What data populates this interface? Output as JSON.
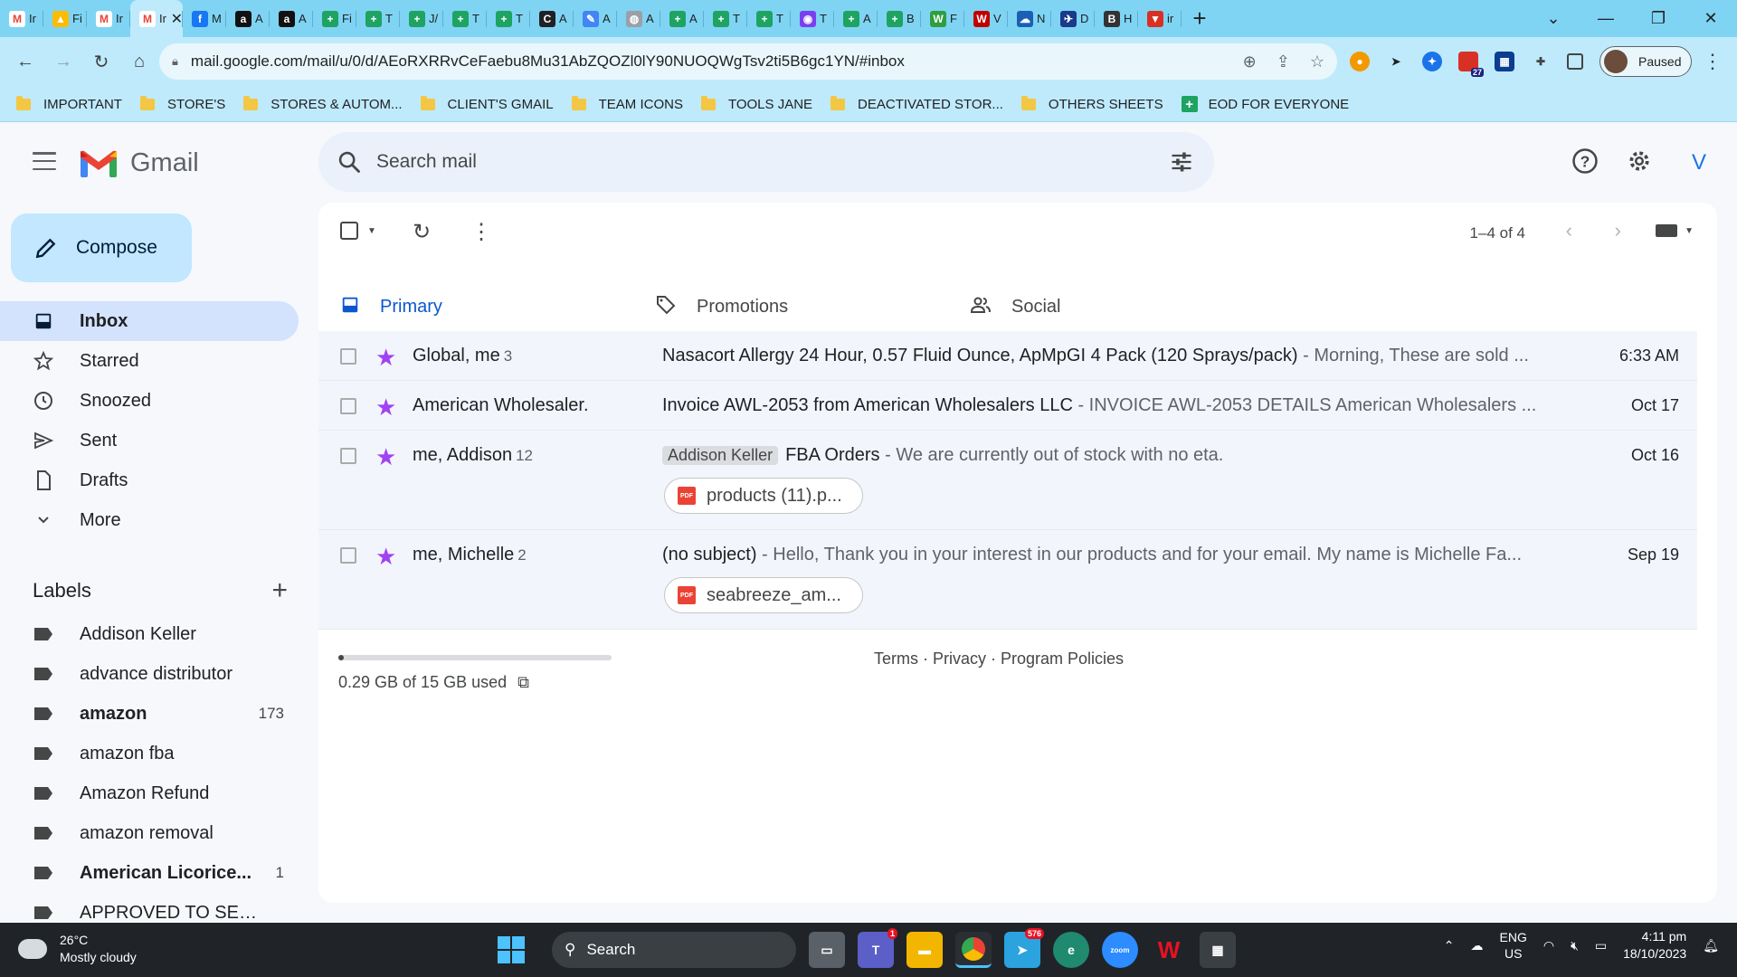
{
  "browser": {
    "tabs": [
      {
        "icon": "gmail-icon",
        "letter": "M",
        "color": "#ffffff",
        "title": "Ir"
      },
      {
        "icon": "drive-icon",
        "letter": "▲",
        "color": "#fbbc04",
        "title": "Fi"
      },
      {
        "icon": "gmail-icon",
        "letter": "M",
        "color": "#ffffff",
        "title": "Ir"
      },
      {
        "icon": "facebook-icon",
        "letter": "f",
        "color": "#1877f2",
        "title": "M"
      },
      {
        "icon": "amazon-icon",
        "letter": "a",
        "color": "#111111",
        "title": "A"
      },
      {
        "icon": "amazon-icon",
        "letter": "a",
        "color": "#111111",
        "title": "A"
      },
      {
        "icon": "sheets-icon",
        "letter": "+",
        "color": "#1ea362",
        "title": "Fi"
      },
      {
        "icon": "sheets-icon",
        "letter": "+",
        "color": "#1ea362",
        "title": "T"
      },
      {
        "icon": "sheets-icon",
        "letter": "+",
        "color": "#1ea362",
        "title": "J/"
      },
      {
        "icon": "sheets-icon",
        "letter": "+",
        "color": "#1ea362",
        "title": "T"
      },
      {
        "icon": "sheets-icon",
        "letter": "+",
        "color": "#1ea362",
        "title": "T"
      },
      {
        "icon": "circle-c-icon",
        "letter": "C",
        "color": "#202124",
        "title": "A"
      },
      {
        "icon": "pen-icon",
        "letter": "✎",
        "color": "#4285f4",
        "title": "A"
      },
      {
        "icon": "globe-icon",
        "letter": "◍",
        "color": "#9aa0a6",
        "title": "A"
      },
      {
        "icon": "sheets-icon",
        "letter": "+",
        "color": "#1ea362",
        "title": "A"
      },
      {
        "icon": "sheets-icon",
        "letter": "+",
        "color": "#1ea362",
        "title": "T"
      },
      {
        "icon": "sheets-icon",
        "letter": "+",
        "color": "#1ea362",
        "title": "T"
      },
      {
        "icon": "chat-icon",
        "letter": "◉",
        "color": "#7b3ff2",
        "title": "T"
      },
      {
        "icon": "sheets-icon",
        "letter": "+",
        "color": "#1ea362",
        "title": "A"
      },
      {
        "icon": "sheets-icon",
        "letter": "+",
        "color": "#1ea362",
        "title": "B"
      },
      {
        "icon": "w-icon",
        "letter": "W",
        "color": "#2e9e3e",
        "title": "F"
      },
      {
        "icon": "vw-icon",
        "letter": "W",
        "color": "#c00000",
        "title": "V"
      },
      {
        "icon": "cloud-icon",
        "letter": "☁",
        "color": "#1a5fb4",
        "title": "N"
      },
      {
        "icon": "wing-icon",
        "letter": "✈",
        "color": "#1a3a8a",
        "title": "D"
      },
      {
        "icon": "b-icon",
        "letter": "B",
        "color": "#333333",
        "title": "H"
      },
      {
        "icon": "v-icon",
        "letter": "▼",
        "color": "#d93025",
        "title": "ir"
      }
    ],
    "active_tab": {
      "title": "Ir",
      "close": "✕"
    },
    "new_tab": "+",
    "url": "mail.google.com/mail/u/0/d/AEoRXRRvCeFaebu8Mu31AbZQOZl0lY90NUOQWgTsv2ti5B6gc1YN/#inbox",
    "profile_status": "Paused",
    "extension_badge": "27",
    "bookmarks": [
      {
        "label": "IMPORTANT",
        "type": "folder"
      },
      {
        "label": "STORE'S",
        "type": "folder"
      },
      {
        "label": "STORES & AUTOM...",
        "type": "folder"
      },
      {
        "label": "CLIENT'S GMAIL",
        "type": "folder"
      },
      {
        "label": "TEAM ICONS",
        "type": "folder"
      },
      {
        "label": "TOOLS JANE",
        "type": "folder"
      },
      {
        "label": "DEACTIVATED STOR...",
        "type": "folder"
      },
      {
        "label": "OTHERS SHEETS",
        "type": "folder"
      },
      {
        "label": "EOD FOR EVERYONE",
        "type": "sheet"
      }
    ]
  },
  "gmail": {
    "app_name": "Gmail",
    "search_placeholder": "Search mail",
    "account_initial": "V",
    "compose_label": "Compose",
    "nav": [
      {
        "label": "Inbox",
        "icon": "inbox-icon",
        "active": true
      },
      {
        "label": "Starred",
        "icon": "star-icon",
        "active": false
      },
      {
        "label": "Snoozed",
        "icon": "clock-icon",
        "active": false
      },
      {
        "label": "Sent",
        "icon": "send-icon",
        "active": false
      },
      {
        "label": "Drafts",
        "icon": "draft-icon",
        "active": false
      },
      {
        "label": "More",
        "icon": "chevron-down-icon",
        "active": false
      }
    ],
    "labels_title": "Labels",
    "labels": [
      {
        "label": "Addison Keller",
        "count": "",
        "bold": false
      },
      {
        "label": "advance distributor",
        "count": "",
        "bold": false
      },
      {
        "label": "amazon",
        "count": "173",
        "bold": true
      },
      {
        "label": "amazon fba",
        "count": "",
        "bold": false
      },
      {
        "label": "Amazon Refund",
        "count": "",
        "bold": false
      },
      {
        "label": "amazon removal",
        "count": "",
        "bold": false
      },
      {
        "label": "American Licorice...",
        "count": "1",
        "bold": true
      },
      {
        "label": "APPROVED TO SELL B...",
        "count": "",
        "bold": false
      }
    ],
    "pager": "1–4 of 4",
    "tabs": [
      {
        "label": "Primary",
        "icon": "inbox-tab-icon",
        "active": true
      },
      {
        "label": "Promotions",
        "icon": "tag-icon",
        "active": false
      },
      {
        "label": "Social",
        "icon": "people-icon",
        "active": false
      }
    ],
    "emails": [
      {
        "from": "Global, me",
        "count": "3",
        "label_chip": "",
        "subject": "Nasacort Allergy 24 Hour, 0.57 Fluid Ounce, ApMpGI 4 Pack (120 Sprays/pack)",
        "snippet": " - Morning, These are sold ...",
        "date": "6:33 AM",
        "attachment": ""
      },
      {
        "from": "American Wholesaler.",
        "count": "",
        "label_chip": "",
        "subject": "Invoice AWL-2053 from American Wholesalers LLC",
        "snippet": " - INVOICE AWL-2053 DETAILS American Wholesalers ...",
        "date": "Oct 17",
        "attachment": ""
      },
      {
        "from": "me, Addison",
        "count": "12",
        "label_chip": "Addison Keller",
        "subject": "FBA Orders",
        "snippet": " - We are currently out of stock with no eta.",
        "date": "Oct 16",
        "attachment": "products (11).p..."
      },
      {
        "from": "me, Michelle",
        "count": "2",
        "label_chip": "",
        "subject": "(no subject)",
        "snippet": " - Hello, Thank you in your interest in our products and for your email. My name is Michelle Fa...",
        "date": "Sep 19",
        "attachment": "seabreeze_am..."
      }
    ],
    "storage": {
      "text": "0.29 GB of 15 GB used",
      "fraction": 0.019
    },
    "footer_links": "Terms · Privacy · Program Policies",
    "pdf_badge": "PDF"
  },
  "taskbar": {
    "weather_temp": "26°C",
    "weather_desc": "Mostly cloudy",
    "search_label": "Search",
    "telegram_badge": "576",
    "teams_badge": "1",
    "lang_top": "ENG",
    "lang_bottom": "US",
    "time": "4:11 pm",
    "date": "18/10/2023"
  }
}
